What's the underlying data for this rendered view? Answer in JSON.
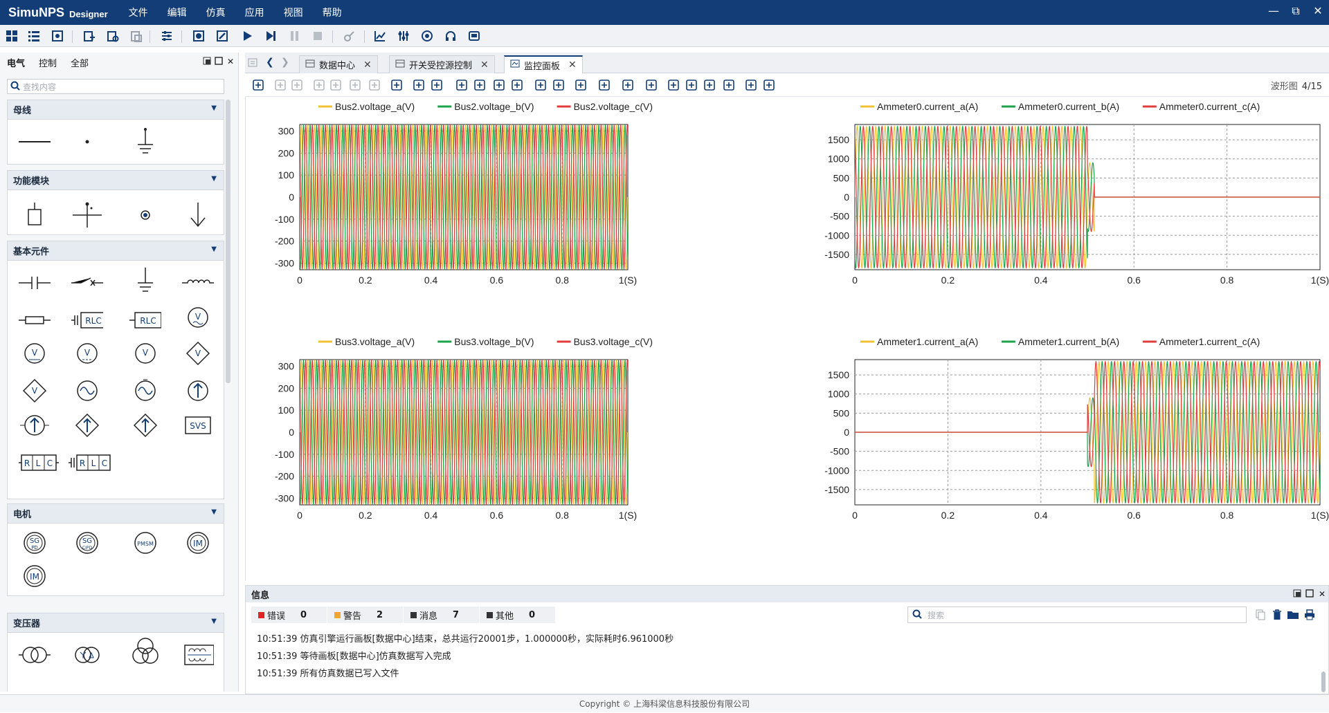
{
  "app": {
    "brand": "SimuNPS",
    "brand_sub": "Designer"
  },
  "menu": [
    "文件",
    "编辑",
    "仿真",
    "应用",
    "视图",
    "帮助"
  ],
  "window_controls": {
    "minimize": "—",
    "restore": "⧉",
    "close": "✕"
  },
  "left_panel": {
    "tabs": [
      "电气",
      "控制",
      "全部"
    ],
    "search_placeholder": "查找内容",
    "categories": [
      {
        "name": "母线",
        "items": [
          "bus-line-icon",
          "node-dot-icon",
          "ground-icon"
        ]
      },
      {
        "name": "功能模块",
        "items": [
          "block-icon",
          "breaker-bar-icon",
          "probe-icon",
          "arrow-down-icon"
        ]
      },
      {
        "name": "基本元件",
        "items": [
          "capacitor-icon",
          "switch-icon",
          "ground-icon",
          "inductor-icon",
          "resistor-icon",
          "rlc-series-icon",
          "rlc-block-icon",
          "ac-voltage-source-icon",
          "voltage-source-icon",
          "dc-voltage-source-icon",
          "voltage-meter-icon",
          "controlled-voltage-source-icon",
          "diamond-voltage-source-icon",
          "sine-source-icon",
          "ac-source-icon",
          "current-source-icon",
          "grounded-current-source-icon",
          "controlled-current-source-icon",
          "diamond-current-source-icon",
          "svs-icon",
          "rlc-branch-icon",
          "rlc-shunt-icon"
        ],
        "texts": {
          "rlc": "RLC",
          "v": "V",
          "svs": "SVS",
          "r": "R",
          "l": "L",
          "c": "C"
        }
      },
      {
        "name": "电机",
        "items": [
          "sg-pd-icon",
          "sg-cipd-icon",
          "pmsm-icon",
          "im-icon",
          "im-grounded-icon"
        ],
        "texts": {
          "sg": "SG",
          "pd": "PD",
          "cipd": "CIPD",
          "pmsm": "PMSM",
          "im": "IM"
        }
      },
      {
        "name": "变压器",
        "items": [
          "two-winding-transformer-icon",
          "yd-transformer-icon",
          "three-winding-transformer-icon",
          "core-transformer-icon"
        ]
      }
    ]
  },
  "doc_tabs": [
    {
      "label": "数据中心",
      "active": false
    },
    {
      "label": "开关受控源控制",
      "active": false
    },
    {
      "label": "监控面板",
      "active": true
    }
  ],
  "chart_toolbar": {
    "page_label": "波形图",
    "page_value": "4/15"
  },
  "colors": {
    "phase_a": "#f0c232",
    "phase_b": "#1aa34a",
    "phase_c": "#e23b3b",
    "accent": "#123d77",
    "error": "#e0242a",
    "warning": "#f0a630",
    "message": "#333333",
    "other": "#333333"
  },
  "chart_data": [
    {
      "type": "line",
      "series": [
        {
          "name": "Bus2.voltage_a(V)",
          "color": "#f0c232",
          "amplitude": 326,
          "freq_hz": 50,
          "phase_deg": 0
        },
        {
          "name": "Bus2.voltage_b(V)",
          "color": "#1aa34a",
          "amplitude": 326,
          "freq_hz": 50,
          "phase_deg": -120
        },
        {
          "name": "Bus2.voltage_c(V)",
          "color": "#e23b3b",
          "amplitude": 326,
          "freq_hz": 50,
          "phase_deg": 120
        }
      ],
      "x_ticks": [
        "0",
        "0.2",
        "0.4",
        "0.6",
        "0.8",
        "1(S)"
      ],
      "y_ticks": [
        "300",
        "200",
        "100",
        "0",
        "-100",
        "-200",
        "-300"
      ],
      "xlim": [
        0,
        1
      ],
      "ylim": [
        -330,
        330
      ],
      "grid": true,
      "legend": "top"
    },
    {
      "type": "line",
      "series": [
        {
          "name": "Ammeter0.current_a(A)",
          "color": "#f0c232",
          "amplitude": 1850,
          "freq_hz": 50,
          "phase_deg": 0,
          "on": [
            0,
            0.5
          ]
        },
        {
          "name": "Ammeter0.current_b(A)",
          "color": "#1aa34a",
          "amplitude": 1850,
          "freq_hz": 50,
          "phase_deg": -120,
          "on": [
            0,
            0.5
          ]
        },
        {
          "name": "Ammeter0.current_c(A)",
          "color": "#e23b3b",
          "amplitude": 1850,
          "freq_hz": 50,
          "phase_deg": 120,
          "on": [
            0,
            0.5
          ]
        }
      ],
      "x_ticks": [
        "0",
        "0.2",
        "0.4",
        "0.6",
        "0.8",
        "1(S)"
      ],
      "y_ticks": [
        "1500",
        "1000",
        "500",
        "0",
        "-500",
        "-1000",
        "-1500"
      ],
      "xlim": [
        0,
        1
      ],
      "ylim": [
        -1900,
        1900
      ],
      "grid": true,
      "legend": "top",
      "transient": {
        "start": 0.5,
        "end": 0.515,
        "peak": 900
      }
    },
    {
      "type": "line",
      "series": [
        {
          "name": "Bus3.voltage_a(V)",
          "color": "#f0c232",
          "amplitude": 326,
          "freq_hz": 50,
          "phase_deg": 0
        },
        {
          "name": "Bus3.voltage_b(V)",
          "color": "#1aa34a",
          "amplitude": 326,
          "freq_hz": 50,
          "phase_deg": -120
        },
        {
          "name": "Bus3.voltage_c(V)",
          "color": "#e23b3b",
          "amplitude": 326,
          "freq_hz": 50,
          "phase_deg": 120
        }
      ],
      "x_ticks": [
        "0",
        "0.2",
        "0.4",
        "0.6",
        "0.8",
        "1(S)"
      ],
      "y_ticks": [
        "300",
        "200",
        "100",
        "0",
        "-100",
        "-200",
        "-300"
      ],
      "xlim": [
        0,
        1
      ],
      "ylim": [
        -330,
        330
      ],
      "grid": true,
      "legend": "top"
    },
    {
      "type": "line",
      "series": [
        {
          "name": "Ammeter1.current_a(A)",
          "color": "#f0c232",
          "amplitude": 1850,
          "freq_hz": 50,
          "phase_deg": 0,
          "on": [
            0.515,
            1
          ]
        },
        {
          "name": "Ammeter1.current_b(A)",
          "color": "#1aa34a",
          "amplitude": 1850,
          "freq_hz": 50,
          "phase_deg": -120,
          "on": [
            0.515,
            1
          ]
        },
        {
          "name": "Ammeter1.current_c(A)",
          "color": "#e23b3b",
          "amplitude": 1850,
          "freq_hz": 50,
          "phase_deg": 120,
          "on": [
            0.515,
            1
          ]
        }
      ],
      "x_ticks": [
        "0",
        "0.2",
        "0.4",
        "0.6",
        "0.8",
        "1(S)"
      ],
      "y_ticks": [
        "1500",
        "1000",
        "500",
        "0",
        "-500",
        "-1000",
        "-1500"
      ],
      "xlim": [
        0,
        1
      ],
      "ylim": [
        -1900,
        1900
      ],
      "grid": true,
      "legend": "top",
      "transient": {
        "start": 0.5,
        "end": 0.515,
        "peak": 900
      }
    }
  ],
  "info_panel": {
    "title": "信息",
    "filters": [
      {
        "label": "错误",
        "count": "0",
        "color": "#e0242a"
      },
      {
        "label": "警告",
        "count": "2",
        "color": "#f0a630"
      },
      {
        "label": "消息",
        "count": "7",
        "color": "#333333"
      },
      {
        "label": "其他",
        "count": "0",
        "color": "#333333"
      }
    ],
    "search_placeholder": "搜索",
    "log": [
      "10:51:39 仿真引擎运行画板[数据中心]结束，总共运行20001步，1.000000秒，实际耗时6.961000秒",
      "10:51:39 等待画板[数据中心]仿真数据写入完成",
      "10:51:39 所有仿真数据已写入文件"
    ]
  },
  "footer": "Copyright © 上海科梁信息科技股份有限公司"
}
